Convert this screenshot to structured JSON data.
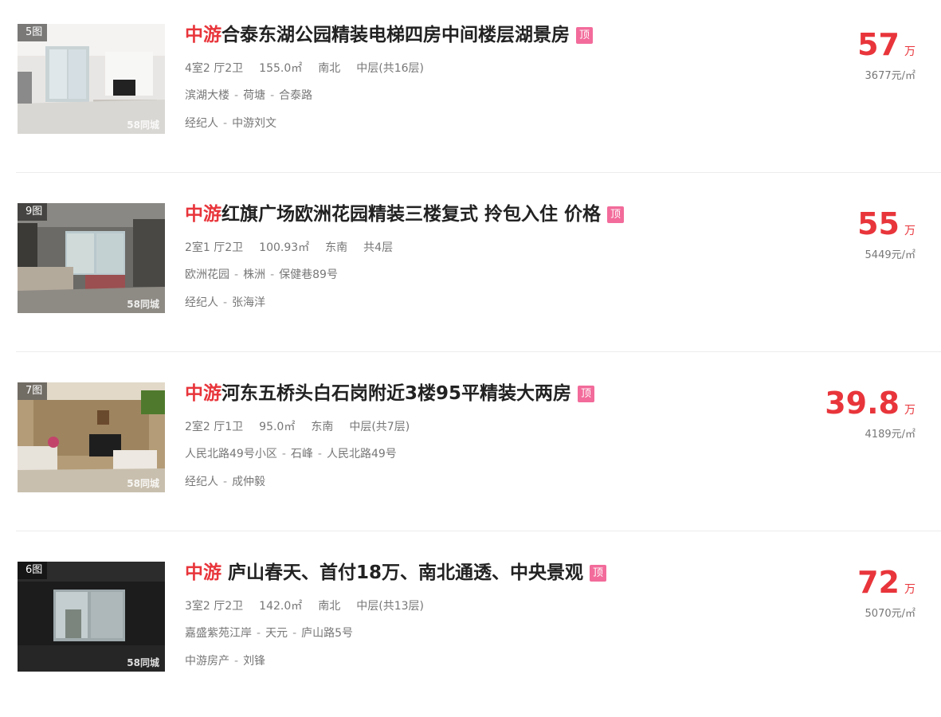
{
  "listings": [
    {
      "photo_count": "5图",
      "watermark": "58同城",
      "brand": "中游",
      "title": "合泰东湖公园精装电梯四房中间楼层湖景房",
      "badge": "顶",
      "layout": "4室2 厅2卫",
      "area": "155.0㎡",
      "orientation": "南北",
      "floor": "中层(共16层)",
      "community": "滨湖大楼",
      "district": "荷塘",
      "road": "合泰路",
      "agent_prefix": "经纪人",
      "agent": "中游刘文",
      "price": "57",
      "price_unit": "万",
      "unit_price": "3677元/㎡",
      "photo_theme": "white-living-room"
    },
    {
      "photo_count": "9图",
      "watermark": "58同城",
      "brand": "中游",
      "title": "红旗广场欧洲花园精装三楼复式 拎包入住 价格",
      "badge": "顶",
      "layout": "2室1 厅2卫",
      "area": "100.93㎡",
      "orientation": "东南",
      "floor": "共4层",
      "community": "欧洲花园",
      "district": "株洲",
      "road": "保健巷89号",
      "agent_prefix": "经纪人",
      "agent": "张海洋",
      "price": "55",
      "price_unit": "万",
      "unit_price": "5449元/㎡",
      "photo_theme": "dark-room-window"
    },
    {
      "photo_count": "7图",
      "watermark": "58同城",
      "brand": "中游",
      "title": "河东五桥头白石岗附近3楼95平精装大两房",
      "badge": "顶",
      "layout": "2室2 厅1卫",
      "area": "95.0㎡",
      "orientation": "东南",
      "floor": "中层(共7层)",
      "community": "人民北路49号小区",
      "district": "石峰",
      "road": "人民北路49号",
      "agent_prefix": "经纪人",
      "agent": "成仲毅",
      "price": "39.8",
      "price_unit": "万",
      "unit_price": "4189元/㎡",
      "photo_theme": "warm-living-room"
    },
    {
      "photo_count": "6图",
      "watermark": "58同城",
      "brand": "中游",
      "title": " 庐山春天、首付18万、南北通透、中央景观",
      "badge": "顶",
      "layout": "3室2 厅2卫",
      "area": "142.0㎡",
      "orientation": "南北",
      "floor": "中层(共13层)",
      "community": "嘉盛紫苑江岸",
      "district": "天元",
      "road": "庐山路5号",
      "agent_prefix": "中游房产",
      "agent": "刘锋",
      "price": "72",
      "price_unit": "万",
      "unit_price": "5070元/㎡",
      "photo_theme": "empty-dark-room"
    }
  ],
  "separator": "-"
}
